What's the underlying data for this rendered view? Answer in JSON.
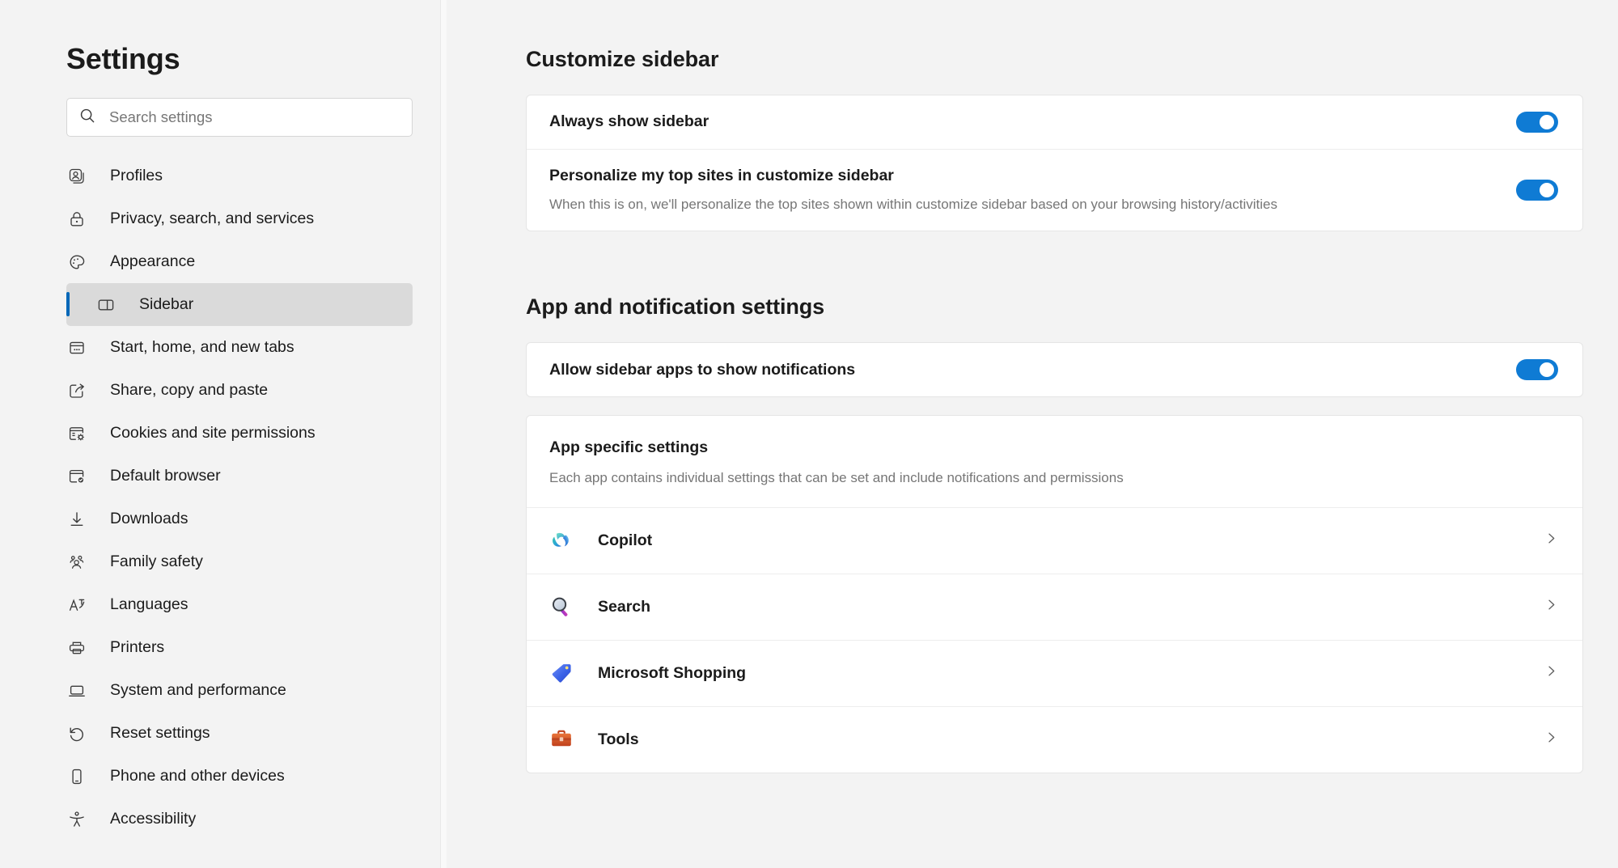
{
  "nav": {
    "title": "Settings",
    "search": {
      "placeholder": "Search settings",
      "value": "",
      "icon": "search-icon"
    },
    "items": [
      {
        "label": "Profiles",
        "icon": "profile-icon",
        "selected": false
      },
      {
        "label": "Privacy, search, and services",
        "icon": "lock-icon",
        "selected": false
      },
      {
        "label": "Appearance",
        "icon": "palette-icon",
        "selected": false
      },
      {
        "label": "Sidebar",
        "icon": "sidebar-icon",
        "selected": true
      },
      {
        "label": "Start, home, and new tabs",
        "icon": "window-dots-icon",
        "selected": false
      },
      {
        "label": "Share, copy and paste",
        "icon": "share-icon",
        "selected": false
      },
      {
        "label": "Cookies and site permissions",
        "icon": "cookie-gear-icon",
        "selected": false
      },
      {
        "label": "Default browser",
        "icon": "browser-check-icon",
        "selected": false
      },
      {
        "label": "Downloads",
        "icon": "download-arrow-icon",
        "selected": false
      },
      {
        "label": "Family safety",
        "icon": "people-icon",
        "selected": false
      },
      {
        "label": "Languages",
        "icon": "translate-icon",
        "selected": false
      },
      {
        "label": "Printers",
        "icon": "printer-icon",
        "selected": false
      },
      {
        "label": "System and performance",
        "icon": "laptop-icon",
        "selected": false
      },
      {
        "label": "Reset settings",
        "icon": "reset-arrow-icon",
        "selected": false
      },
      {
        "label": "Phone and other devices",
        "icon": "phone-icon",
        "selected": false
      },
      {
        "label": "Accessibility",
        "icon": "accessibility-icon",
        "selected": false
      }
    ]
  },
  "content": {
    "section1": {
      "heading": "Customize sidebar",
      "rows": [
        {
          "title": "Always show sidebar",
          "desc": "",
          "toggle": "on"
        },
        {
          "title": "Personalize my top sites in customize sidebar",
          "desc": "When this is on, we'll personalize the top sites shown within customize sidebar based on your browsing history/activities",
          "toggle": "on"
        }
      ]
    },
    "section2": {
      "heading": "App and notification settings",
      "rows": [
        {
          "title": "Allow sidebar apps to show notifications",
          "desc": "",
          "toggle": "on"
        }
      ],
      "app_specific": {
        "title": "App specific settings",
        "desc": "Each app contains individual settings that can be set and include notifications and permissions",
        "apps": [
          {
            "label": "Copilot",
            "icon": "copilot-icon",
            "chevron": "chevron-right-icon"
          },
          {
            "label": "Search",
            "icon": "search-app-icon",
            "chevron": "chevron-right-icon"
          },
          {
            "label": "Microsoft Shopping",
            "icon": "shopping-tag-icon",
            "chevron": "chevron-right-icon"
          },
          {
            "label": "Tools",
            "icon": "toolbox-icon",
            "chevron": "chevron-right-icon"
          }
        ]
      }
    }
  },
  "colors": {
    "accent": "#0067b8",
    "toggle_on": "#0f7bd4",
    "page_bg": "#f3f3f3",
    "card_bg": "#ffffff",
    "selected_nav_bg": "#dadada",
    "muted_text": "#767676"
  }
}
